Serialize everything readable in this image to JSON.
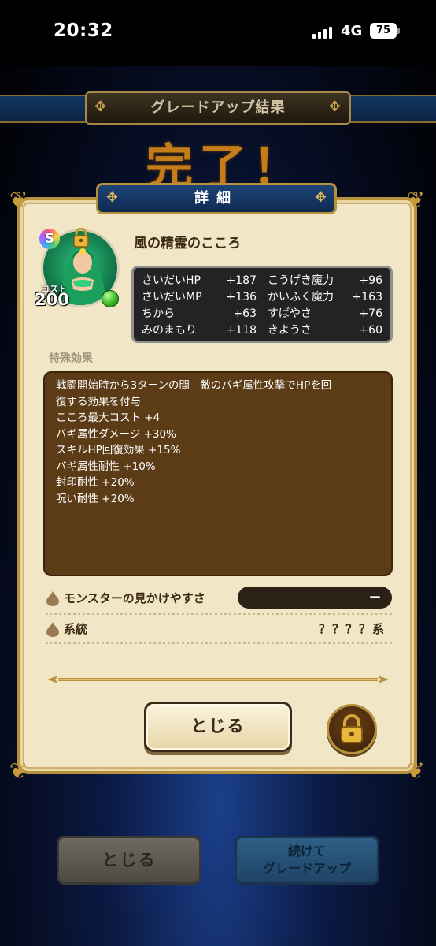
{
  "status_bar": {
    "time": "20:32",
    "network": "4G",
    "battery": "75"
  },
  "banner": {
    "title": "グレードアップ結果",
    "big_title": "完了！"
  },
  "panel": {
    "tab_title": "詳細",
    "item": {
      "rank": "S",
      "name": "風の精霊のこころ",
      "cost_label": "コスト",
      "cost_value": "200"
    },
    "stats": [
      {
        "label": "さいだいHP",
        "value": "+187"
      },
      {
        "label": "こうげき魔力",
        "value": "+96"
      },
      {
        "label": "さいだいMP",
        "value": "+136"
      },
      {
        "label": "かいふく魔力",
        "value": "+163"
      },
      {
        "label": "ちから",
        "value": "+63"
      },
      {
        "label": "すばやさ",
        "value": "+76"
      },
      {
        "label": "みのまもり",
        "value": "+118"
      },
      {
        "label": "きようさ",
        "value": "+60"
      }
    ],
    "special_effects_title": "特殊効果",
    "special_effects": [
      "戦闘開始時から3ターンの間　敵のバギ属性攻撃でHPを回",
      "復する効果を付与",
      "こころ最大コスト +4",
      "バギ属性ダメージ +30%",
      "スキルHP回復効果 +15%",
      "バギ属性耐性 +10%",
      "封印耐性 +20%",
      "呪い耐性 +20%"
    ],
    "appearance": {
      "label": "モンスターの見かけやすさ",
      "value": "ー"
    },
    "family": {
      "label": "系統",
      "value": "？？？？系"
    },
    "close_label": "とじる"
  },
  "footer": {
    "close_label": "とじる",
    "continue_line1": "続けて",
    "continue_line2": "グレードアップ"
  },
  "colors": {
    "panel_bg": "#f1e6c6",
    "gold_border": "#b8913c",
    "effects_bg": "#5c3b17",
    "stats_bg": "#232323",
    "tab_blue": "#1c4476"
  }
}
